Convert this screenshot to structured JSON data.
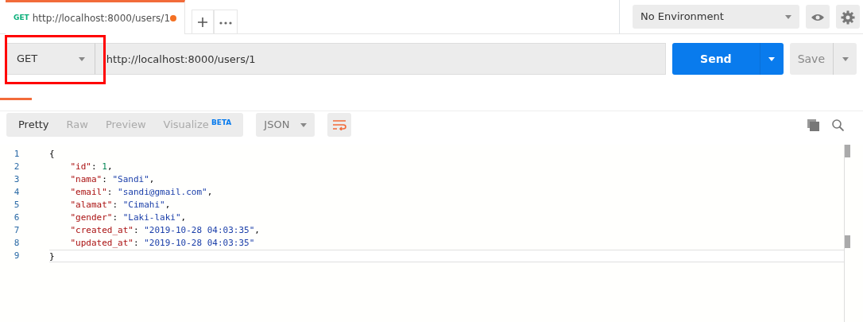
{
  "request_tab": {
    "method": "GET",
    "title": "http://localhost:8000/users/1",
    "unsaved": true,
    "selected": true
  },
  "environment": {
    "value": "No Environment"
  },
  "request": {
    "method": "GET",
    "method_highlighted": true,
    "url": "http://localhost:8000/users/1",
    "send_label": "Send",
    "save_label": "Save"
  },
  "response_views": [
    {
      "label": "Pretty",
      "selected": true
    },
    {
      "label": "Raw",
      "selected": false
    },
    {
      "label": "Preview",
      "selected": false
    },
    {
      "label": "Visualize",
      "badge": "BETA",
      "selected": false
    }
  ],
  "format": {
    "value": "JSON"
  },
  "wrap_lines": true,
  "code": {
    "lines": [
      {
        "number": "1",
        "current": false,
        "tokens": [
          {
            "kind": "punct",
            "text": "{"
          }
        ]
      },
      {
        "number": "2",
        "current": false,
        "tokens": [
          {
            "kind": "key",
            "text": "\"id\""
          },
          {
            "kind": "punct",
            "text": ": "
          },
          {
            "kind": "number",
            "text": "1"
          },
          {
            "kind": "punct",
            "text": ","
          }
        ]
      },
      {
        "number": "3",
        "current": false,
        "tokens": [
          {
            "kind": "key",
            "text": "\"nama\""
          },
          {
            "kind": "punct",
            "text": ": "
          },
          {
            "kind": "string",
            "text": "\"Sandi\""
          },
          {
            "kind": "punct",
            "text": ","
          }
        ]
      },
      {
        "number": "4",
        "current": false,
        "tokens": [
          {
            "kind": "key",
            "text": "\"email\""
          },
          {
            "kind": "punct",
            "text": ": "
          },
          {
            "kind": "string",
            "text": "\"sandi@gmail.com\""
          },
          {
            "kind": "punct",
            "text": ","
          }
        ]
      },
      {
        "number": "5",
        "current": false,
        "tokens": [
          {
            "kind": "key",
            "text": "\"alamat\""
          },
          {
            "kind": "punct",
            "text": ": "
          },
          {
            "kind": "string",
            "text": "\"Cimahi\""
          },
          {
            "kind": "punct",
            "text": ","
          }
        ]
      },
      {
        "number": "6",
        "current": false,
        "tokens": [
          {
            "kind": "key",
            "text": "\"gender\""
          },
          {
            "kind": "punct",
            "text": ": "
          },
          {
            "kind": "string",
            "text": "\"Laki-laki\""
          },
          {
            "kind": "punct",
            "text": ","
          }
        ]
      },
      {
        "number": "7",
        "current": false,
        "tokens": [
          {
            "kind": "key",
            "text": "\"created_at\""
          },
          {
            "kind": "punct",
            "text": ": "
          },
          {
            "kind": "string",
            "text": "\"2019-10-28 04:03:35\""
          },
          {
            "kind": "punct",
            "text": ","
          }
        ]
      },
      {
        "number": "8",
        "current": false,
        "tokens": [
          {
            "kind": "key",
            "text": "\"updated_at\""
          },
          {
            "kind": "punct",
            "text": ": "
          },
          {
            "kind": "string",
            "text": "\"2019-10-28 04:03:35\""
          }
        ]
      },
      {
        "number": "9",
        "current": true,
        "tokens": [
          {
            "kind": "punct",
            "text": "}"
          }
        ]
      }
    ]
  }
}
